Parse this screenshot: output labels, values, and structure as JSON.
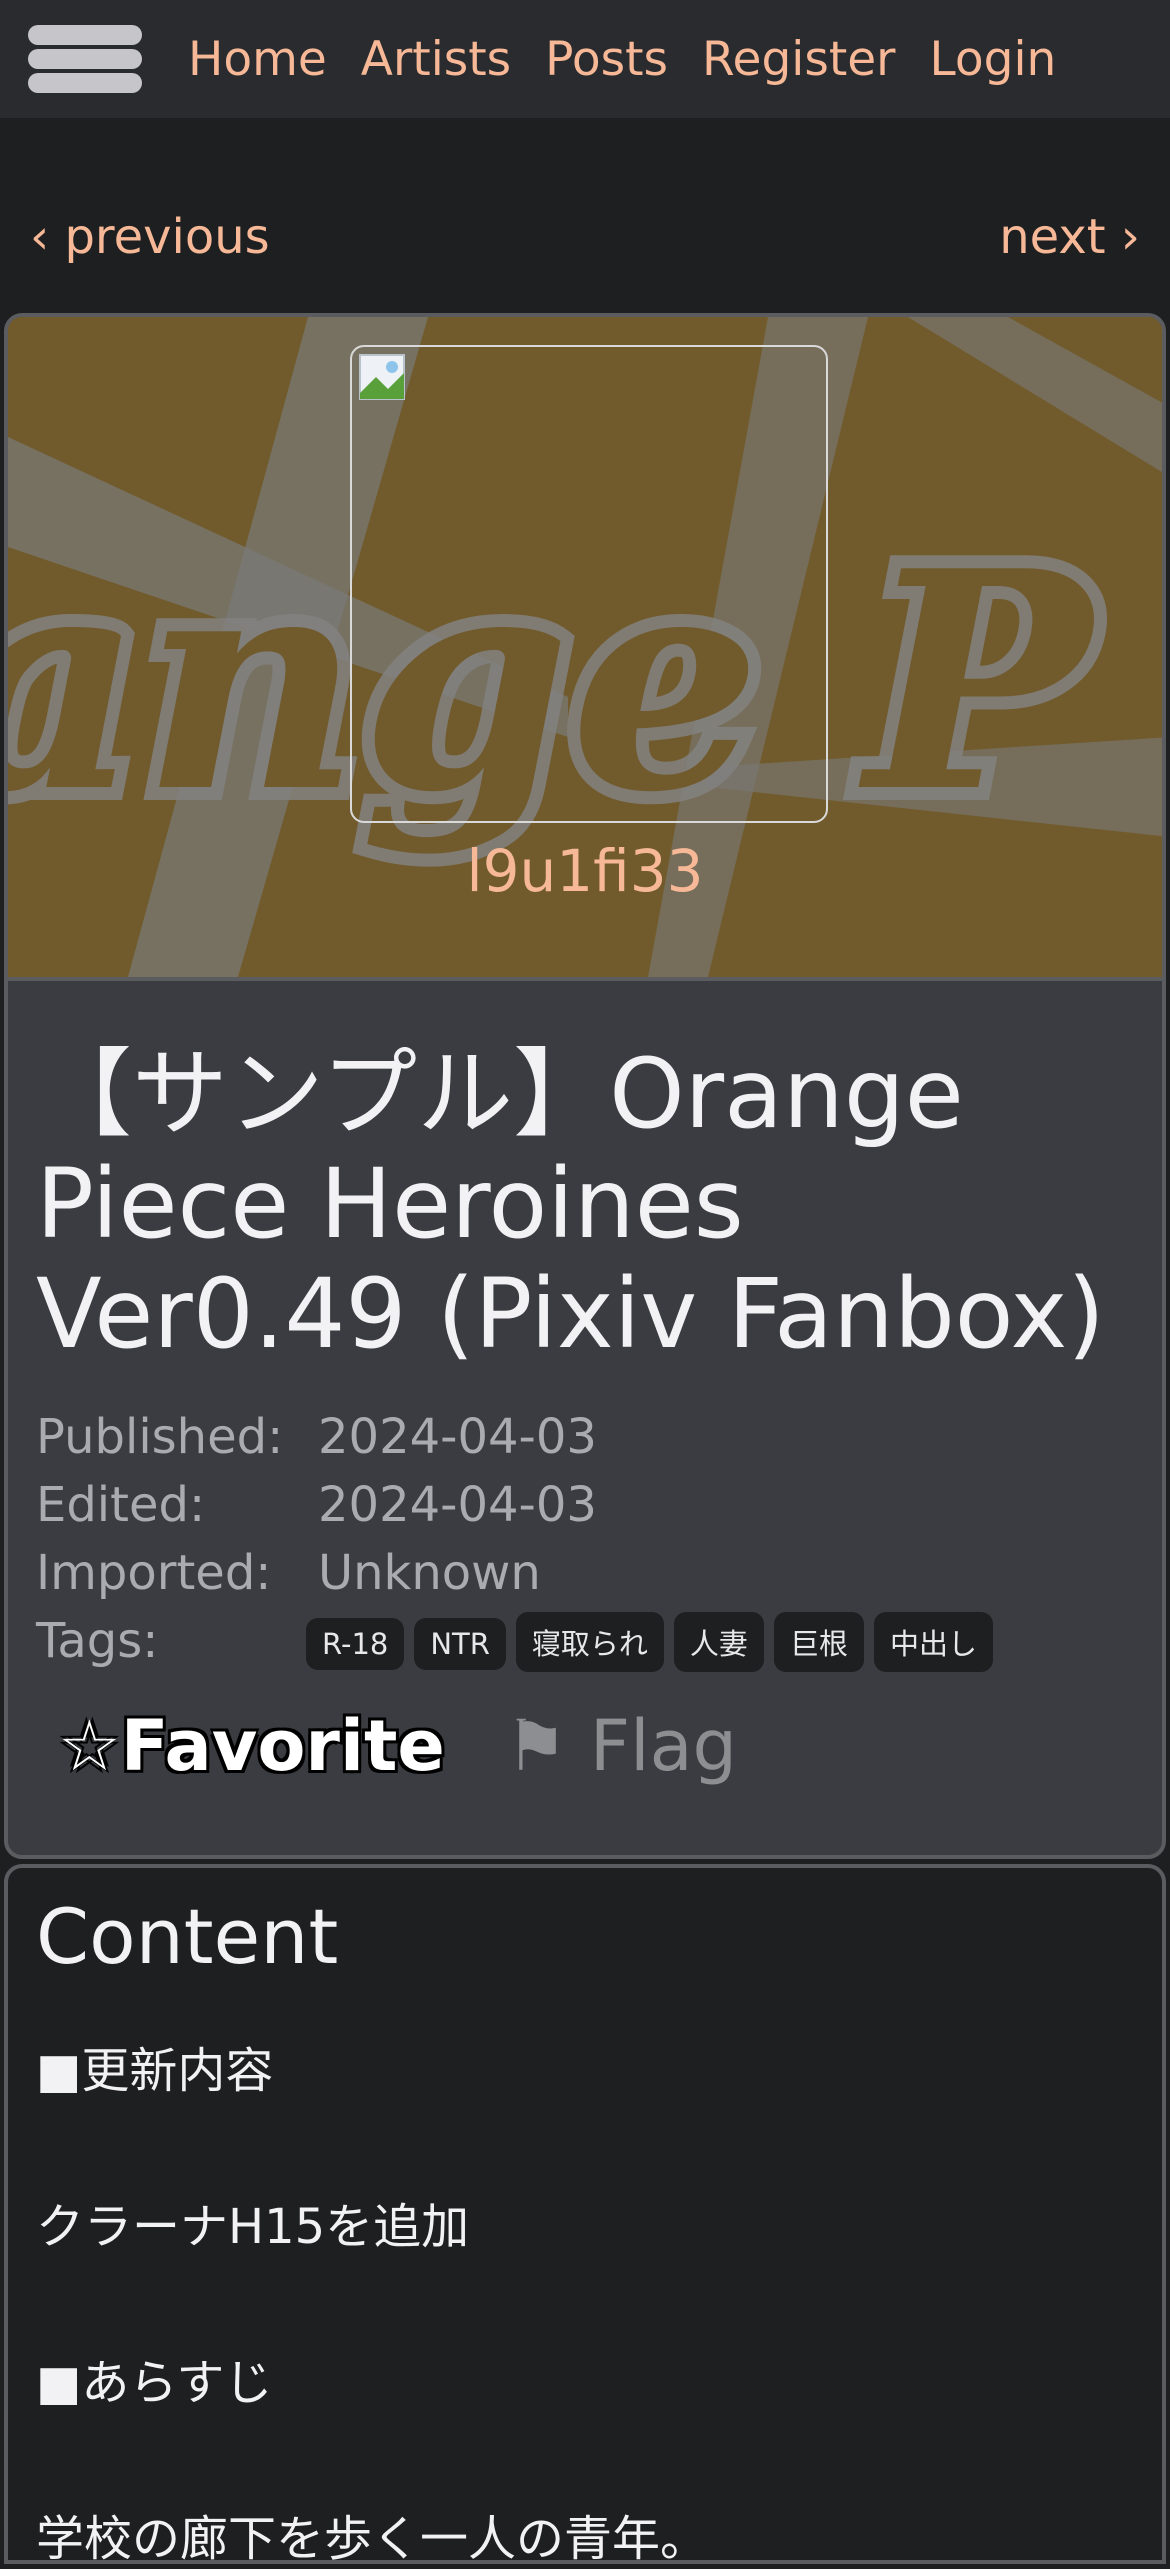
{
  "nav": {
    "items": [
      {
        "label": "Home"
      },
      {
        "label": "Artists"
      },
      {
        "label": "Posts"
      },
      {
        "label": "Register"
      },
      {
        "label": "Login"
      }
    ]
  },
  "pager": {
    "previous": "‹ previous",
    "next": "next ›"
  },
  "artist": {
    "name": "l9u1fi33"
  },
  "post": {
    "title": "【サンプル】Orange Piece Heroines Ver0.49 (Pixiv Fanbox)",
    "meta": [
      {
        "key": "Published:",
        "value": "2024-04-03"
      },
      {
        "key": "Edited:",
        "value": "2024-04-03"
      },
      {
        "key": "Imported:",
        "value": "Unknown"
      }
    ],
    "tags_label": "Tags:",
    "tags": [
      "R-18",
      "NTR",
      "寝取られ",
      "人妻",
      "巨根",
      "中出し"
    ],
    "favorite": "☆Favorite",
    "flag": "⚑ Flag"
  },
  "content": {
    "heading": "Content",
    "lines": [
      "■更新内容",
      "クラーナH15を追加",
      "■あらすじ",
      "学校の廊下を歩く一人の青年。"
    ]
  },
  "colors": {
    "accent": "#f6b896",
    "banner": "#7d5a10"
  }
}
